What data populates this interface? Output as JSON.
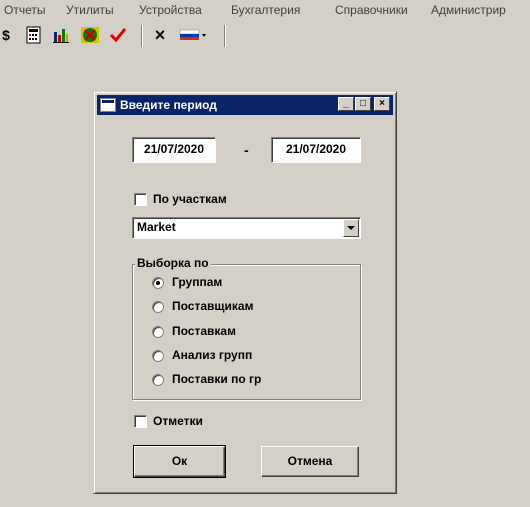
{
  "menu": {
    "items": [
      "Отчеты",
      "Утилиты",
      "Устройства",
      "Бухгалтерия",
      "Справочники",
      "Администрир"
    ]
  },
  "toolbar": {
    "icons": [
      "dollar-icon",
      "calculator-icon",
      "bar-chart-icon",
      "refresh-icon",
      "check-icon",
      "close-icon",
      "flag-icon"
    ],
    "dollar_glyph": "$",
    "close_glyph": "×",
    "dropdown_glyph": "▾"
  },
  "dialog": {
    "title": "Введите период",
    "controls": {
      "minimize": "_",
      "maximize": "□",
      "close": "×"
    },
    "date_from": "21/07/2020",
    "date_separator": "-",
    "date_to": "21/07/2020",
    "by_sites_label": "По участкам",
    "by_sites_checked": false,
    "site_value": "Market",
    "selection_group_title": "Выборка по",
    "options": [
      {
        "label": "Группам",
        "checked": true
      },
      {
        "label": "Поставщикам",
        "checked": false
      },
      {
        "label": "Поставкам",
        "checked": false
      },
      {
        "label": "Анализ групп",
        "checked": false
      },
      {
        "label": "Поставки по гр",
        "checked": false
      }
    ],
    "marks_label": "Отметки",
    "marks_checked": false,
    "ok_label": "Ок",
    "cancel_label": "Отмена"
  },
  "colors": {
    "face": "#d4d0c8",
    "titlebar": "#0a246a",
    "title_text": "#ffffff"
  }
}
